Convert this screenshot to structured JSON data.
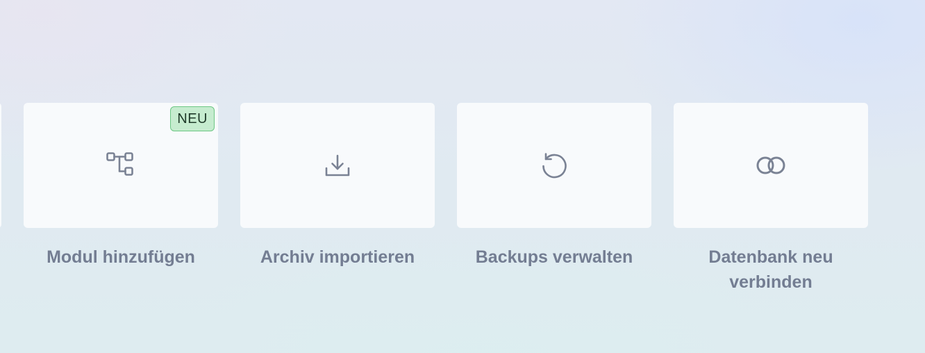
{
  "tiles": [
    {
      "label": "Modul hinzufügen",
      "icon": "module-tree-icon",
      "badge": "NEU"
    },
    {
      "label": "Archiv importieren",
      "icon": "download-icon"
    },
    {
      "label": "Backups verwalten",
      "icon": "restore-icon"
    },
    {
      "label": "Datenbank neu verbinden",
      "icon": "linked-rings-icon"
    }
  ],
  "colors": {
    "card": "#f8fafc",
    "icon": "#7a8294",
    "label": "#737d92",
    "badge_bg": "#c6eccf",
    "badge_border": "#6cc784"
  }
}
